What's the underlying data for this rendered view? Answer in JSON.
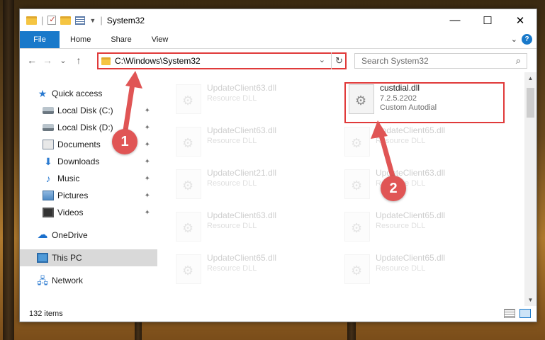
{
  "window": {
    "title": "System32",
    "controls": {
      "minimize": "—",
      "maximize": "☐",
      "close": "✕"
    }
  },
  "ribbon": {
    "tabs": [
      "File",
      "Home",
      "Share",
      "View"
    ],
    "expand_icon": "chevron-down-icon",
    "help": "?"
  },
  "navigation": {
    "back": "←",
    "forward": "→",
    "recent": "⌄",
    "up": "↑",
    "address": "C:\\Windows\\System32",
    "address_dropdown": "⌄",
    "refresh": "↻",
    "search_placeholder": "Search System32",
    "search_icon": "⌕"
  },
  "sidebar": {
    "items": [
      {
        "label": "Quick access",
        "icon": "star-icon",
        "pinned": false
      },
      {
        "label": "Local Disk (C:)",
        "icon": "disk-icon",
        "pinned": true
      },
      {
        "label": "Local Disk (D:)",
        "icon": "disk-icon",
        "pinned": true
      },
      {
        "label": "Documents",
        "icon": "documents-icon",
        "pinned": true
      },
      {
        "label": "Downloads",
        "icon": "download-icon",
        "pinned": true
      },
      {
        "label": "Music",
        "icon": "music-icon",
        "pinned": true
      },
      {
        "label": "Pictures",
        "icon": "pictures-icon",
        "pinned": true
      },
      {
        "label": "Videos",
        "icon": "videos-icon",
        "pinned": true
      },
      {
        "label": "OneDrive",
        "icon": "cloud-icon",
        "pinned": false
      },
      {
        "label": "This PC",
        "icon": "pc-icon",
        "pinned": false,
        "selected": true
      },
      {
        "label": "Network",
        "icon": "network-icon",
        "pinned": false
      }
    ],
    "pin_glyph": "📌"
  },
  "files": [
    {
      "name": "UpdateClient63.dll",
      "type": "Resource DLL",
      "faded": true
    },
    {
      "name": "custdial.dll",
      "version": "7.2.5.2202",
      "description": "Custom Autodial",
      "faded": false,
      "highlighted": true
    },
    {
      "name": "UpdateClient63.dll",
      "type": "Resource DLL",
      "faded": true
    },
    {
      "name": "UpdateClient65.dll",
      "type": "Resource DLL",
      "faded": true
    },
    {
      "name": "UpdateClient21.dll",
      "type": "Resource DLL",
      "faded": true
    },
    {
      "name": "UpdateClient63.dll",
      "type": "Resource DLL",
      "faded": true
    },
    {
      "name": "UpdateClient63.dll",
      "type": "Resource DLL",
      "faded": true
    },
    {
      "name": "UpdateClient65.dll",
      "type": "Resource DLL",
      "faded": true
    },
    {
      "name": "UpdateClient65.dll",
      "type": "Resource DLL",
      "faded": true
    },
    {
      "name": "UpdateClient65.dll",
      "type": "Resource DLL",
      "faded": true
    }
  ],
  "annotations": {
    "callout_1": "1",
    "callout_2": "2",
    "highlight_color": "#e03a3a"
  },
  "status": {
    "item_count": "132 items"
  },
  "colors": {
    "accent": "#1979ca",
    "selected_bg": "#d9d9d9",
    "annotation_red": "#e05555"
  }
}
